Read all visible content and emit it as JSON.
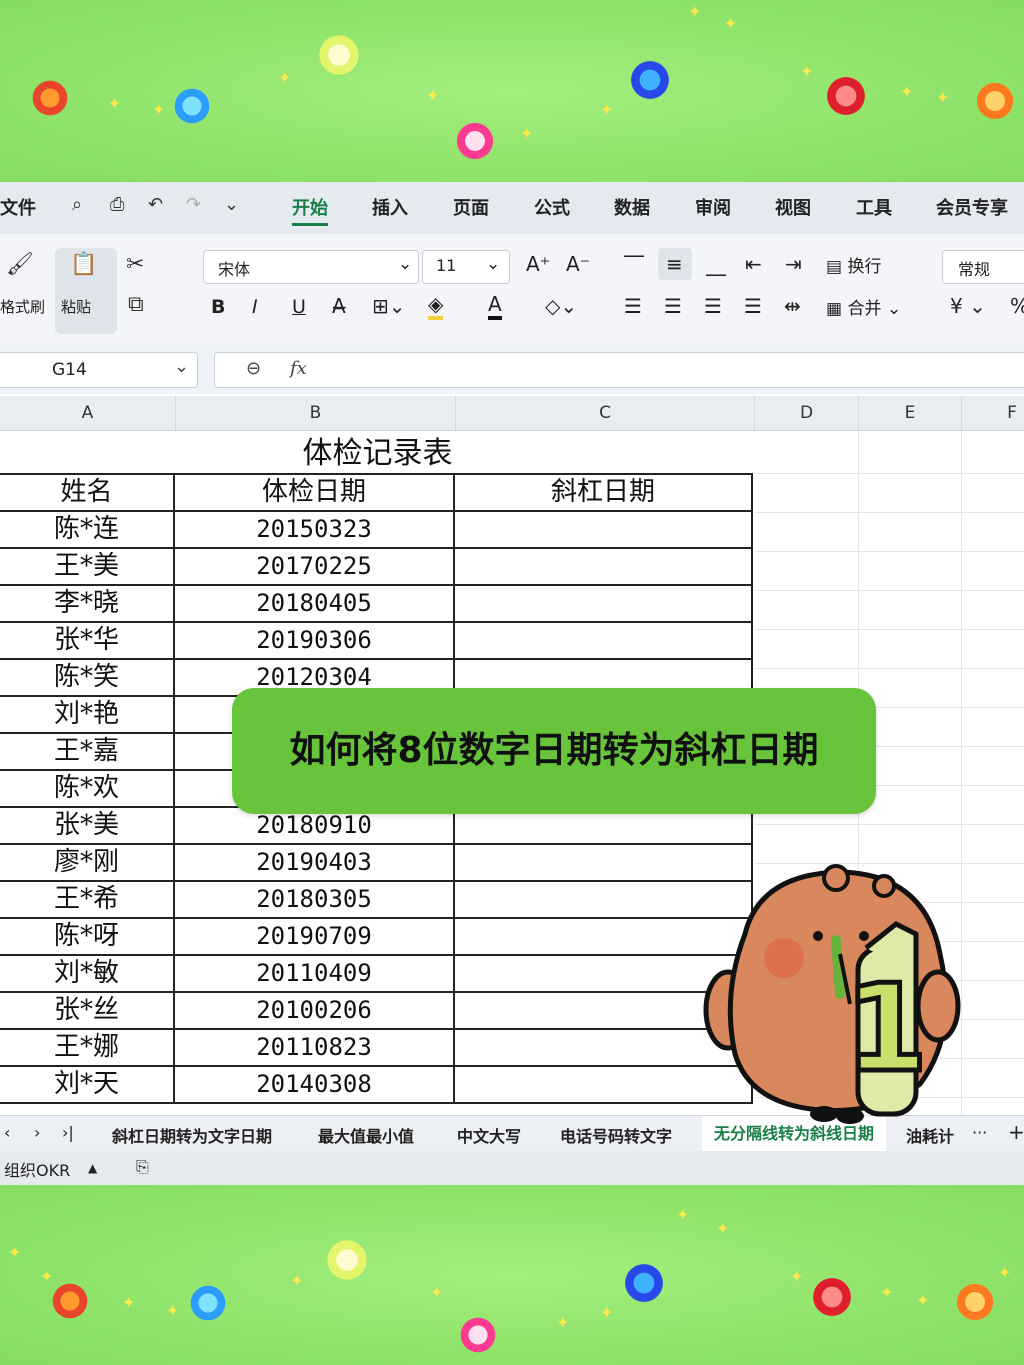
{
  "menu": {
    "file": "文件",
    "tabs": [
      "开始",
      "插入",
      "页面",
      "公式",
      "数据",
      "审阅",
      "视图",
      "工具",
      "会员专享"
    ],
    "active_tab": "开始"
  },
  "ribbon": {
    "format_painter": "格式刷",
    "paste": "粘贴",
    "font_name": "宋体",
    "font_size": "11",
    "wrap": "换行",
    "merge": "合并",
    "number_format": "常规",
    "bold": "B",
    "italic": "I",
    "underline": "U"
  },
  "formula_bar": {
    "cell_ref": "G14",
    "fx": "fx",
    "content": ""
  },
  "columns": [
    "A",
    "B",
    "C",
    "D",
    "E",
    "F"
  ],
  "sheet": {
    "title": "体检记录表",
    "headers": [
      "姓名",
      "体检日期",
      "斜杠日期"
    ],
    "rows": [
      {
        "name": "陈*连",
        "date": "20150323",
        "slash": ""
      },
      {
        "name": "王*美",
        "date": "20170225",
        "slash": ""
      },
      {
        "name": "李*晓",
        "date": "20180405",
        "slash": ""
      },
      {
        "name": "张*华",
        "date": "20190306",
        "slash": ""
      },
      {
        "name": "陈*笑",
        "date": "20120304",
        "slash": ""
      },
      {
        "name": "刘*艳",
        "date": "",
        "slash": ""
      },
      {
        "name": "王*嘉",
        "date": "",
        "slash": ""
      },
      {
        "name": "陈*欢",
        "date": "",
        "slash": ""
      },
      {
        "name": "张*美",
        "date": "20180910",
        "slash": ""
      },
      {
        "name": "廖*刚",
        "date": "20190403",
        "slash": ""
      },
      {
        "name": "王*希",
        "date": "20180305",
        "slash": ""
      },
      {
        "name": "陈*呀",
        "date": "20190709",
        "slash": ""
      },
      {
        "name": "刘*敏",
        "date": "20110409",
        "slash": ""
      },
      {
        "name": "张*丝",
        "date": "20100206",
        "slash": ""
      },
      {
        "name": "王*娜",
        "date": "20110823",
        "slash": ""
      },
      {
        "name": "刘*天",
        "date": "20140308",
        "slash": ""
      }
    ]
  },
  "sheet_tabs": [
    "斜杠日期转为文字日期",
    "最大值最小值",
    "中文大写",
    "电话号码转文字",
    "无分隔线转为斜线日期",
    "油耗计"
  ],
  "active_sheet_tab": "无分隔线转为斜线日期",
  "status": {
    "okr": "组织OKR"
  },
  "banner_text": "如何将8位数字日期转为斜杠日期",
  "mascot_number": "1",
  "colors": {
    "accent_green": "#1a7f47",
    "banner_green": "#67c43b",
    "background_green": "#8fe36a"
  }
}
